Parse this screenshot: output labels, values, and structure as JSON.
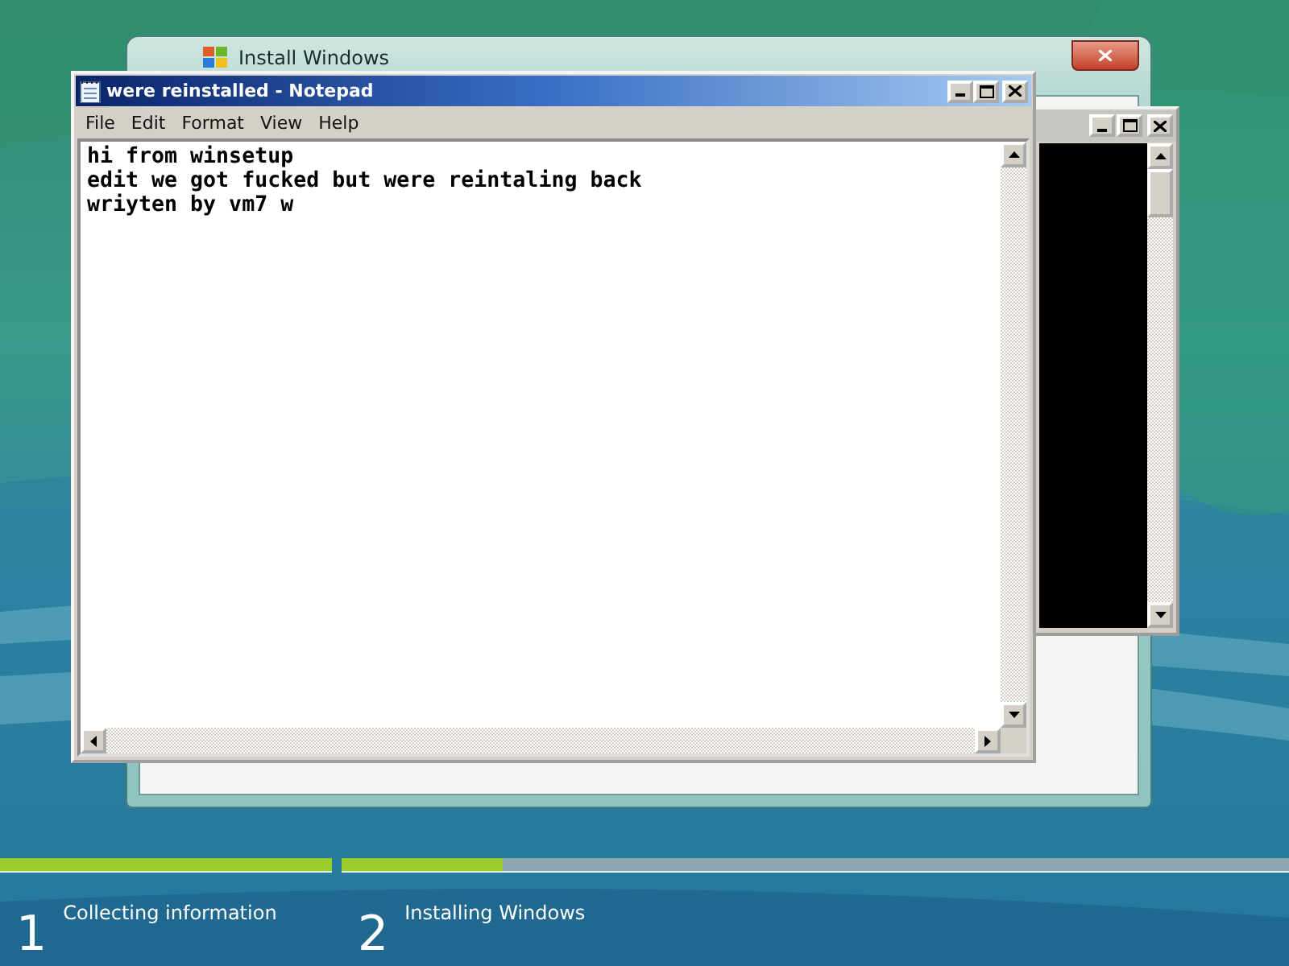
{
  "setup_window": {
    "title": "Install Windows"
  },
  "notepad": {
    "title": "were reinstalled - Notepad",
    "menu": [
      "File",
      "Edit",
      "Format",
      "View",
      "Help"
    ],
    "lines": [
      "hi from winsetup",
      "edit we got fucked but were reintaling back",
      "wriyten by vm7 w"
    ]
  },
  "progress_steps": [
    {
      "number": "1",
      "label": "Collecting information",
      "level": 1
    },
    {
      "number": "2",
      "label": "Installing Windows",
      "level": 0.17
    }
  ]
}
